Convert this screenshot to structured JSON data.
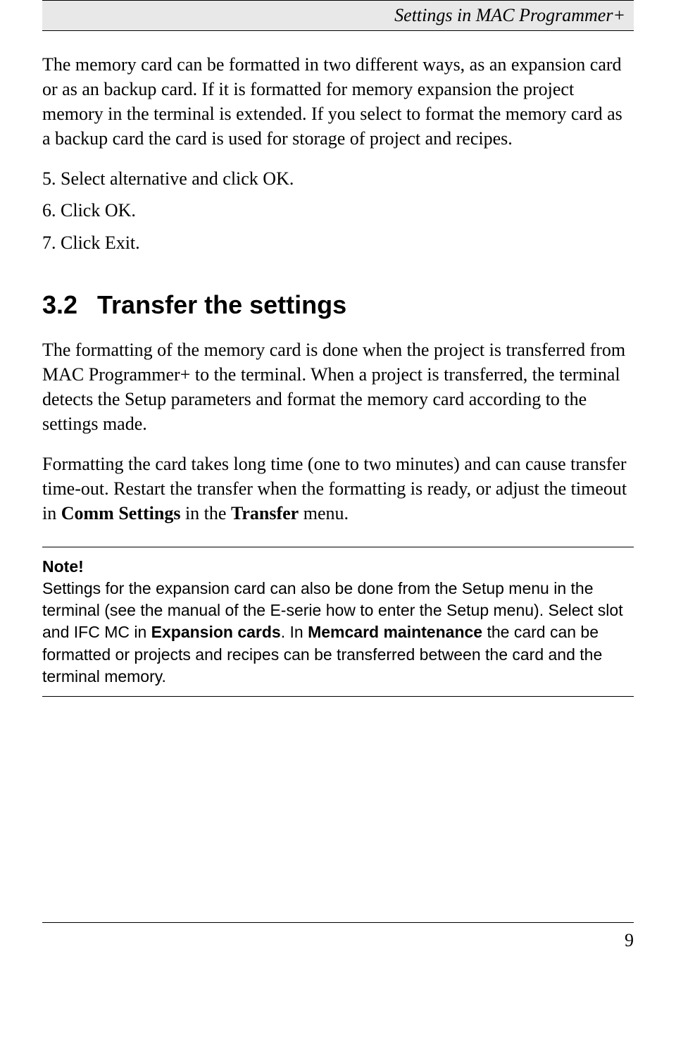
{
  "header": {
    "title": "Settings in MAC Programmer+"
  },
  "intro": {
    "paragraph": "The memory card can be formatted in two different ways, as an expansion card or as an backup card. If it is formatted for memory expansion the project memory in the terminal is extended. If you select to format the memory card as a backup card the card is used for storage of project and recipes."
  },
  "steps": {
    "s5": "5. Select alternative and click OK.",
    "s6": "6. Click OK.",
    "s7": "7. Click Exit."
  },
  "section": {
    "number": "3.2",
    "title": "Transfer the settings",
    "p1": "The formatting of the memory card is done when the project is transferred from MAC Programmer+ to the terminal. When a project is transferred, the terminal detects the Setup parameters and format the memory card according to the settings made.",
    "p2_pre": "Formatting the card takes long time (one to two minutes) and can cause transfer time-out. Restart the transfer when the formatting is ready, or adjust the timeout in ",
    "p2_b1": "Comm Settings",
    "p2_mid": " in the ",
    "p2_b2": "Transfer",
    "p2_post": " menu."
  },
  "note": {
    "title": "Note!",
    "t1": "Settings for the expansion card can also be done from the Setup menu in the terminal (see the manual of the E-serie how to enter the Setup menu). Select slot and IFC MC in ",
    "b1": "Expansion cards",
    "t2": ". In ",
    "b2": "Memcard maintenance",
    "t3": " the card can be formatted or projects and recipes can be transferred between the card and the terminal memory."
  },
  "footer": {
    "page": "9"
  }
}
